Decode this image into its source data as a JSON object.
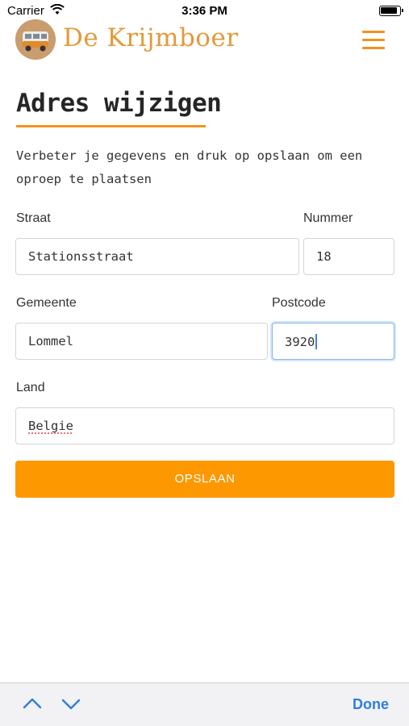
{
  "status_bar": {
    "carrier": "Carrier",
    "time": "3:36 PM"
  },
  "header": {
    "brand": "De Krijmboer",
    "menu_icon": "hamburger-menu-icon",
    "accent_color": "#f0921e"
  },
  "page": {
    "title": "Adres wijzigen",
    "intro": "Verbeter je gegevens en druk op opslaan om een oproep te plaatsen"
  },
  "form": {
    "straat": {
      "label": "Straat",
      "value": "Stationsstraat"
    },
    "nummer": {
      "label": "Nummer",
      "value": "18"
    },
    "gemeente": {
      "label": "Gemeente",
      "value": "Lommel"
    },
    "postcode": {
      "label": "Postcode",
      "value": "3920",
      "focused": true
    },
    "land": {
      "label": "Land",
      "value": "Belgie"
    },
    "save_label": "OPSLAAN",
    "button_color": "#fd9800"
  },
  "keyboard_bar": {
    "prev_icon": "chevron-up-icon",
    "next_icon": "chevron-down-icon",
    "done_label": "Done"
  }
}
